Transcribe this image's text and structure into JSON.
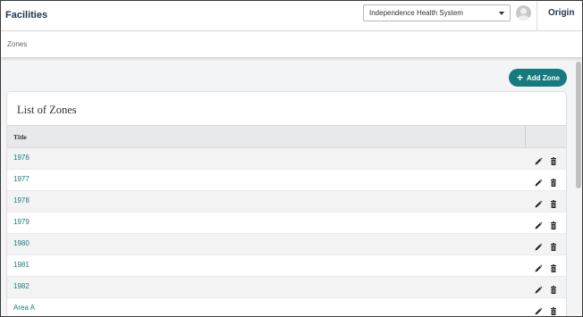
{
  "header": {
    "app_title": "Facilities",
    "org_selector": {
      "selected": "Independence Health System"
    },
    "brand": "Origin"
  },
  "breadcrumb": {
    "current": "Zones"
  },
  "actions": {
    "add_label": "Add Zone"
  },
  "list": {
    "heading": "List of Zones",
    "columns": [
      "Title",
      ""
    ],
    "rows": [
      {
        "title": "1976"
      },
      {
        "title": "1977"
      },
      {
        "title": "1978"
      },
      {
        "title": "1979"
      },
      {
        "title": "1980"
      },
      {
        "title": "1981"
      },
      {
        "title": "1982"
      },
      {
        "title": "Area A"
      }
    ]
  },
  "colors": {
    "accent": "#167b7e",
    "link": "#1a7d82",
    "title": "#1e3550"
  }
}
